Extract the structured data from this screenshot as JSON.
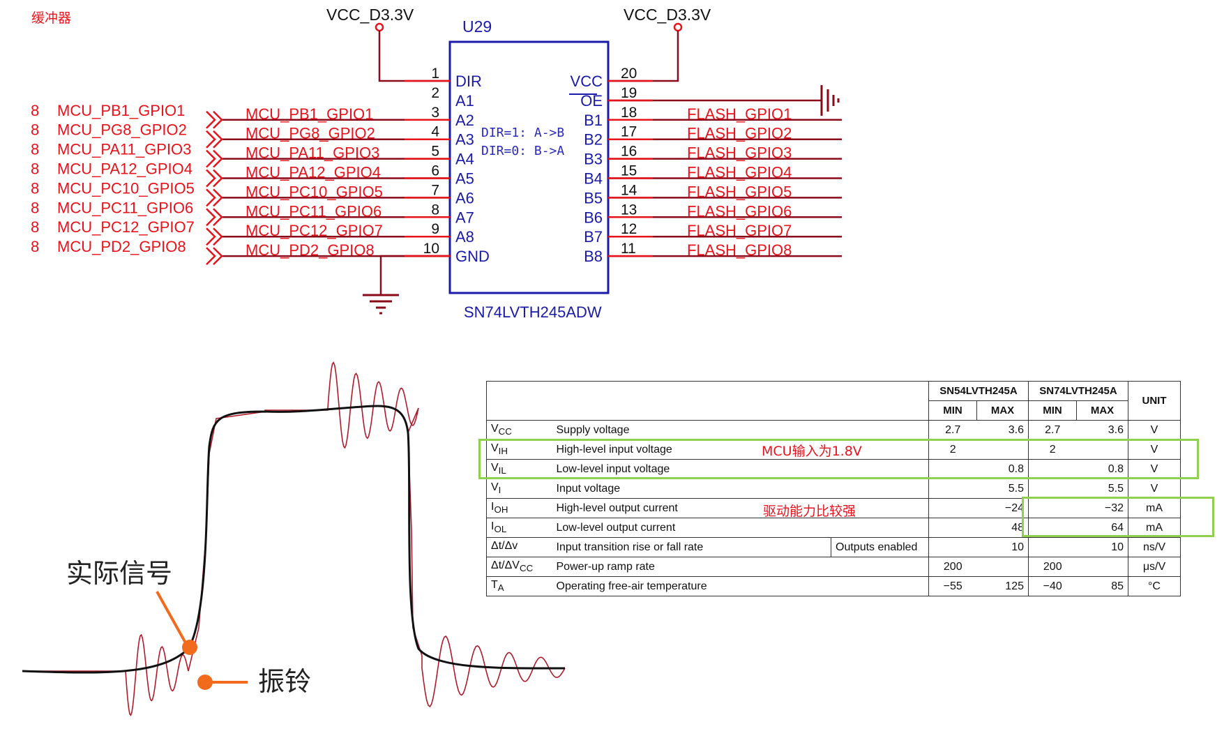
{
  "corner_label": "缓冲器",
  "chip": {
    "ref": "U29",
    "part": "SN74LVTH245ADW",
    "note_line1": "DIR=1: A->B",
    "note_line2": "DIR=0: B->A",
    "pin_names_left": [
      "DIR",
      "A1",
      "A2",
      "A3",
      "A4",
      "A5",
      "A6",
      "A7",
      "A8",
      "GND"
    ],
    "pin_nums_left": [
      "1",
      "2",
      "3",
      "4",
      "5",
      "6",
      "7",
      "8",
      "9",
      "10"
    ],
    "pin_names_right": [
      "VCC",
      "OE",
      "B1",
      "B2",
      "B3",
      "B4",
      "B5",
      "B6",
      "B7",
      "B8"
    ],
    "pin_nums_right": [
      "20",
      "19",
      "18",
      "17",
      "16",
      "15",
      "14",
      "13",
      "12",
      "11"
    ]
  },
  "power": {
    "left_label": "VCC_D3.3V",
    "right_label": "VCC_D3.3V"
  },
  "ports_left": [
    {
      "sheet": "8",
      "name": "MCU_PB1_GPIO1",
      "net": "MCU_PB1_GPIO1"
    },
    {
      "sheet": "8",
      "name": "MCU_PG8_GPIO2",
      "net": "MCU_PG8_GPIO2"
    },
    {
      "sheet": "8",
      "name": "MCU_PA11_GPIO3",
      "net": "MCU_PA11_GPIO3"
    },
    {
      "sheet": "8",
      "name": "MCU_PA12_GPIO4",
      "net": "MCU_PA12_GPIO4"
    },
    {
      "sheet": "8",
      "name": "MCU_PC10_GPIO5",
      "net": "MCU_PC10_GPIO5"
    },
    {
      "sheet": "8",
      "name": "MCU_PC11_GPIO6",
      "net": "MCU_PC11_GPIO6"
    },
    {
      "sheet": "8",
      "name": "MCU_PC12_GPIO7",
      "net": "MCU_PC12_GPIO7"
    },
    {
      "sheet": "8",
      "name": "MCU_PD2_GPIO8",
      "net": "MCU_PD2_GPIO8"
    }
  ],
  "nets_right": [
    "FLASH_GPIO1",
    "FLASH_GPIO2",
    "FLASH_GPIO3",
    "FLASH_GPIO4",
    "FLASH_GPIO5",
    "FLASH_GPIO6",
    "FLASH_GPIO7",
    "FLASH_GPIO8"
  ],
  "waveform": {
    "label_actual": "实际信号",
    "label_ringing": "振铃"
  },
  "table": {
    "head": {
      "part1": "SN54LVTH245A",
      "part2": "SN74LVTH245A",
      "unit": "UNIT",
      "min": "MIN",
      "max": "MAX"
    },
    "rows": [
      {
        "sym": "V",
        "sub": "CC",
        "desc": "Supply voltage",
        "cond": "",
        "min1": "2.7",
        "max1": "3.6",
        "min2": "2.7",
        "max2": "3.6",
        "unit": "V"
      },
      {
        "sym": "V",
        "sub": "IH",
        "desc": "High-level input voltage",
        "cond": "",
        "min1": "2",
        "max1": "",
        "min2": "2",
        "max2": "",
        "unit": "V"
      },
      {
        "sym": "V",
        "sub": "IL",
        "desc": "Low-level input voltage",
        "cond": "",
        "min1": "",
        "max1": "0.8",
        "min2": "",
        "max2": "0.8",
        "unit": "V"
      },
      {
        "sym": "V",
        "sub": "I",
        "desc": "Input voltage",
        "cond": "",
        "min1": "",
        "max1": "5.5",
        "min2": "",
        "max2": "5.5",
        "unit": "V"
      },
      {
        "sym": "I",
        "sub": "OH",
        "desc": "High-level output current",
        "cond": "",
        "min1": "",
        "max1": "−24",
        "min2": "",
        "max2": "−32",
        "unit": "mA"
      },
      {
        "sym": "I",
        "sub": "OL",
        "desc": "Low-level output current",
        "cond": "",
        "min1": "",
        "max1": "48",
        "min2": "",
        "max2": "64",
        "unit": "mA"
      },
      {
        "sym": "Δt/Δv",
        "sub": "",
        "desc": "Input transition rise or fall rate",
        "cond": "Outputs enabled",
        "min1": "",
        "max1": "10",
        "min2": "",
        "max2": "10",
        "unit": "ns/V"
      },
      {
        "sym": "Δt/ΔV",
        "sub": "CC",
        "desc": "Power-up ramp rate",
        "cond": "",
        "min1": "200",
        "max1": "",
        "min2": "200",
        "max2": "",
        "unit": "μs/V"
      },
      {
        "sym": "T",
        "sub": "A",
        "desc": "Operating free-air temperature",
        "cond": "",
        "min1": "−55",
        "max1": "125",
        "min2": "−40",
        "max2": "85",
        "unit": "°C"
      }
    ],
    "note_vih": "MCU输入为1.8V",
    "note_drive": "驱动能力比较强"
  },
  "colors": {
    "wire": "#8b0a1a",
    "net_text": "#e8131a",
    "chip": "#1a1aa8",
    "highlight": "#8fd14f",
    "orange": "#f26b1d"
  }
}
